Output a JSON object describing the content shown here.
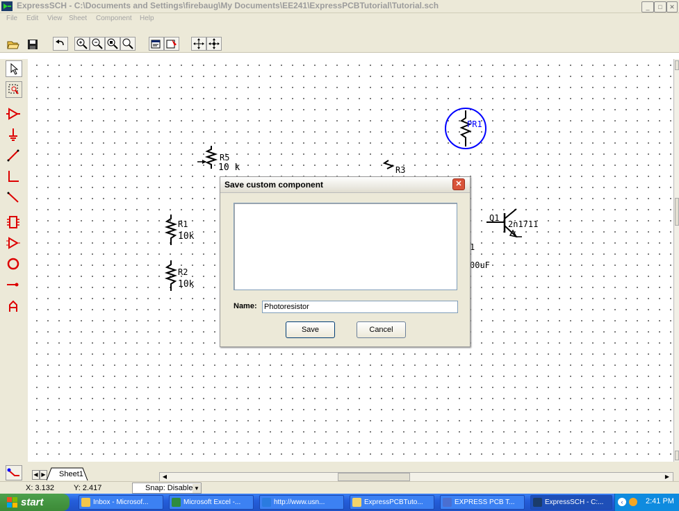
{
  "window": {
    "title": "ExpressSCH - C:\\Documents and Settings\\firebaug\\My Documents\\EE241\\ExpressPCBTutorial\\Tutorial.sch",
    "minimize": "_",
    "maximize": "□",
    "close": "✕"
  },
  "menu": [
    "File",
    "Edit",
    "View",
    "Sheet",
    "Component",
    "Help"
  ],
  "toolbar": {
    "icons": [
      "open-icon",
      "save-icon",
      "undo-icon",
      "zoom-in-icon",
      "zoom-out-icon",
      "zoom-area-icon",
      "zoom-fit-icon",
      "properties-icon",
      "component-properties-icon",
      "pan-icon",
      "center-icon"
    ]
  },
  "left_tools": [
    "pointer-tool",
    "select-area-tool",
    "component-tool",
    "ground-tool",
    "wire-tool",
    "corner-wire-tool",
    "diagonal-wire-tool",
    "ic-tool",
    "buffer-tool",
    "circle-tool",
    "pin-tool",
    "text-tool"
  ],
  "schematic": {
    "components": [
      {
        "ref": "PR1",
        "value": ""
      },
      {
        "ref": "R5",
        "value": "10 k"
      },
      {
        "ref": "R3",
        "value": ""
      },
      {
        "ref": "R1",
        "value": "10k"
      },
      {
        "ref": "R2",
        "value": "10k"
      },
      {
        "ref": "Q1",
        "value": "2n1711"
      }
    ],
    "partial_labels": [
      "1",
      "00uF"
    ],
    "colors": {
      "selected": "#0000ff",
      "normal": "#000000",
      "tool_accent": "#dd0000"
    }
  },
  "sheet_tab": "Sheet1",
  "status": {
    "x": "X: 3.132",
    "y": "Y: 2.417",
    "snap": "Snap: Disabled"
  },
  "dialog": {
    "title": "Save custom component",
    "name_label": "Name:",
    "name_value": "Photoresistor",
    "save_label": "Save",
    "cancel_label": "Cancel",
    "close_glyph": "✕"
  },
  "taskbar": {
    "start": "start",
    "tasks": [
      "Inbox - Microsof...",
      "Microsoft Excel -...",
      "http://www.usn...",
      "ExpressPCBTuto...",
      "EXPRESS PCB T...",
      "ExpressSCH - C:..."
    ],
    "clock": "2:41 PM"
  }
}
